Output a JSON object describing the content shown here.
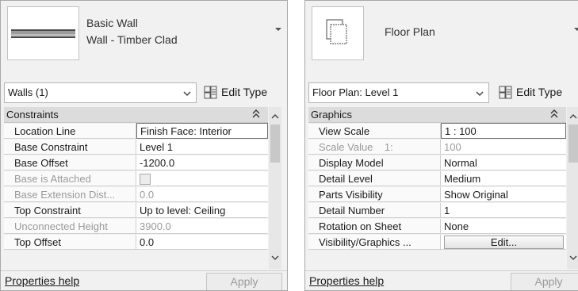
{
  "wall_panel": {
    "type_name": "Basic Wall",
    "type_subname": "Wall - Timber Clad",
    "selector": "Walls (1)",
    "edit_type": "Edit Type",
    "category": "Constraints",
    "rows": [
      {
        "name": "Location Line",
        "value": "Finish Face: Interior",
        "readonly": false
      },
      {
        "name": "Base Constraint",
        "value": "Level 1",
        "readonly": false
      },
      {
        "name": "Base Offset",
        "value": "-1200.0",
        "readonly": false
      },
      {
        "name": "Base is Attached",
        "value": "",
        "readonly": true,
        "checkbox": true
      },
      {
        "name": "Base Extension Dist...",
        "value": "0.0",
        "readonly": true
      },
      {
        "name": "Top Constraint",
        "value": "Up to level: Ceiling",
        "readonly": false
      },
      {
        "name": "Unconnected Height",
        "value": "3900.0",
        "readonly": true
      },
      {
        "name": "Top Offset",
        "value": "0.0",
        "readonly": false
      }
    ],
    "help": "Properties help",
    "apply": "Apply"
  },
  "view_panel": {
    "type_name": "Floor Plan",
    "selector": "Floor Plan: Level 1",
    "edit_type": "Edit Type",
    "category": "Graphics",
    "rows": [
      {
        "name": "View Scale",
        "value": "1 : 100",
        "readonly": false
      },
      {
        "name": "Scale Value    1:",
        "value": "100",
        "readonly": true
      },
      {
        "name": "Display Model",
        "value": "Normal",
        "readonly": false
      },
      {
        "name": "Detail Level",
        "value": "Medium",
        "readonly": false
      },
      {
        "name": "Parts Visibility",
        "value": "Show Original",
        "readonly": false
      },
      {
        "name": "Detail Number",
        "value": "1",
        "readonly": false
      },
      {
        "name": "Rotation on Sheet",
        "value": "None",
        "readonly": false
      },
      {
        "name": "Visibility/Graphics ...",
        "value": "Edit...",
        "readonly": false,
        "button": true
      }
    ],
    "help": "Properties help",
    "apply": "Apply"
  }
}
